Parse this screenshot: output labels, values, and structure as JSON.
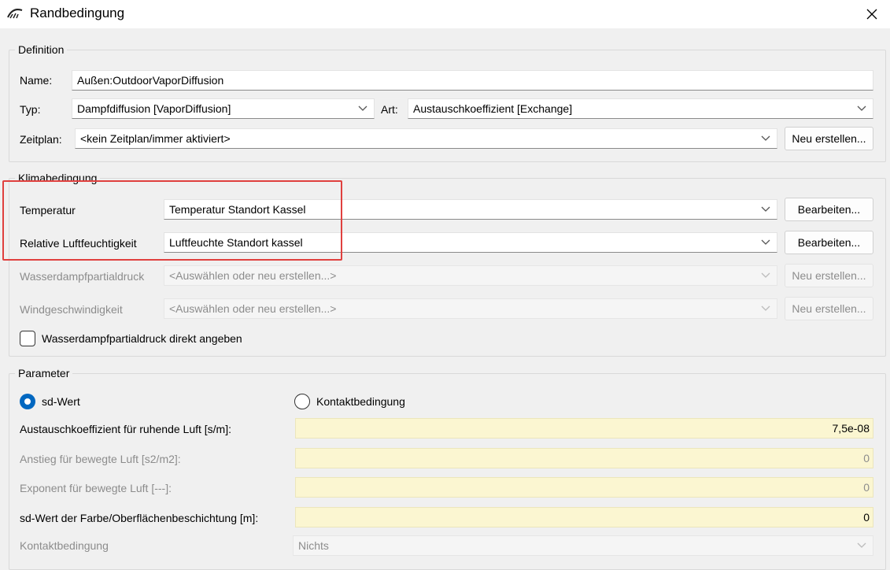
{
  "window": {
    "title": "Randbedingung",
    "app_icon": "app-logo-icon",
    "close_icon": "close-icon"
  },
  "definition": {
    "legend": "Definition",
    "name_label": "Name:",
    "name_value": "Außen:OutdoorVaporDiffusion",
    "typ_label": "Typ:",
    "typ_value": "Dampfdiffusion [VaporDiffusion]",
    "art_label": "Art:",
    "art_value": "Austauschkoeffizient [Exchange]",
    "zeitplan_label": "Zeitplan:",
    "zeitplan_value": "<kein Zeitplan/immer aktiviert>",
    "neu_button": "Neu erstellen..."
  },
  "klima": {
    "legend": "Klimabedingung",
    "temperatur_label": "Temperatur",
    "temperatur_value": "Temperatur Standort Kassel",
    "temperatur_button": "Bearbeiten...",
    "feuchte_label": "Relative Luftfeuchtigkeit",
    "feuchte_value": "Luftfeuchte Standort kassel",
    "feuchte_button": "Bearbeiten...",
    "partialdruck_label": "Wasserdampfpartialdruck",
    "partialdruck_value": "<Auswählen oder neu erstellen...>",
    "partialdruck_button": "Neu erstellen...",
    "wind_label": "Windgeschwindigkeit",
    "wind_value": "<Auswählen oder neu erstellen...>",
    "wind_button": "Neu erstellen...",
    "checkbox_label": "Wasserdampfpartialdruck direkt angeben",
    "checkbox_checked": false,
    "highlight_color": "#e0403e"
  },
  "parameter": {
    "legend": "Parameter",
    "radio_sd": "sd-Wert",
    "radio_kontakt": "Kontaktbedingung",
    "selected": "sd-Wert",
    "austausch_label": "Austauschkoeffizient für ruhende Luft [s/m]:",
    "austausch_value": "7,5e-08",
    "anstieg_label": "Anstieg für bewegte Luft [s2/m2]:",
    "anstieg_value": "0",
    "exponent_label": "Exponent für bewegte Luft [---]:",
    "exponent_value": "0",
    "sdfarbe_label": "sd-Wert der Farbe/Oberflächenbeschichtung [m]:",
    "sdfarbe_value": "0",
    "kontakt_label": "Kontaktbedingung",
    "kontakt_value": "Nichts"
  }
}
